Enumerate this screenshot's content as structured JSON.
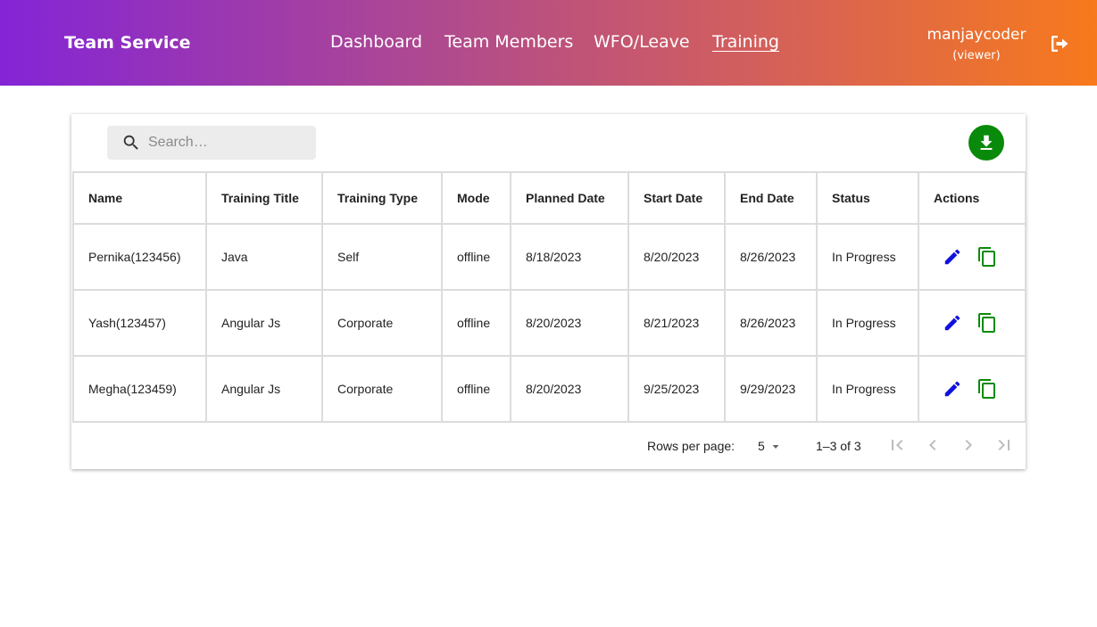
{
  "app": {
    "brand": "Team Service"
  },
  "nav": [
    {
      "label": "Dashboard",
      "active": false
    },
    {
      "label": "Team Members",
      "active": false
    },
    {
      "label": "WFO/Leave",
      "active": false
    },
    {
      "label": "Training",
      "active": true
    }
  ],
  "user": {
    "name": "manjaycoder",
    "role": "(viewer)"
  },
  "search": {
    "placeholder": "Search…",
    "value": ""
  },
  "table": {
    "columns": [
      "Name",
      "Training Title",
      "Training Type",
      "Mode",
      "Planned Date",
      "Start Date",
      "End Date",
      "Status",
      "Actions"
    ],
    "rows": [
      [
        "Pernika(123456)",
        "Java",
        "Self",
        "offline",
        "8/18/2023",
        "8/20/2023",
        "8/26/2023",
        "In Progress"
      ],
      [
        "Yash(123457)",
        "Angular Js",
        "Corporate",
        "offline",
        "8/20/2023",
        "8/21/2023",
        "8/26/2023",
        "In Progress"
      ],
      [
        "Megha(123459)",
        "Angular Js",
        "Corporate",
        "offline",
        "8/20/2023",
        "9/25/2023",
        "9/29/2023",
        "In Progress"
      ]
    ]
  },
  "pagination": {
    "rows_per_page_label": "Rows per page:",
    "rows_per_page": "5",
    "range": "1–3 of 3"
  },
  "icons": {
    "search": "search-icon",
    "download": "download-icon",
    "logout": "logout-icon",
    "edit": "edit-icon",
    "copy": "copy-icon",
    "first": "first-page-icon",
    "prev": "chevron-left-icon",
    "next": "chevron-right-icon",
    "last": "last-page-icon"
  },
  "colors": {
    "gradient_start": "#8424d6",
    "gradient_end": "#f77a1c",
    "edit": "#1111dd",
    "copy": "#0a8a0a",
    "download": "#0a8a0a"
  }
}
